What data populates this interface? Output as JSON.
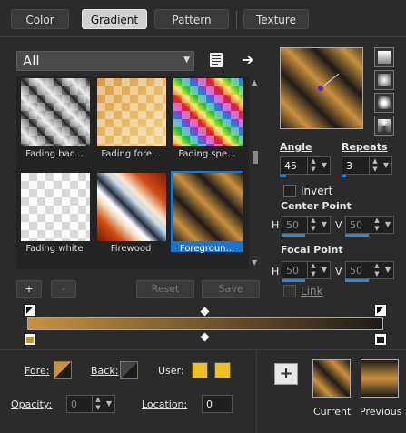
{
  "tabs": [
    {
      "label": "Color",
      "active": false
    },
    {
      "label": "Gradient",
      "active": true
    },
    {
      "label": "Pattern",
      "active": false
    },
    {
      "label": "Texture",
      "active": false
    }
  ],
  "library": {
    "selected": "All",
    "items": [
      {
        "label": "Fading bac...",
        "selected": false
      },
      {
        "label": "Fading fore...",
        "selected": false
      },
      {
        "label": "Fading spe...",
        "selected": false
      },
      {
        "label": "Fading white",
        "selected": false
      },
      {
        "label": "Firewood",
        "selected": false
      },
      {
        "label": "Foregroun...",
        "selected": true
      }
    ]
  },
  "controls": {
    "add": "+",
    "remove": "-",
    "reset": "Reset",
    "save": "Save"
  },
  "properties": {
    "angle_label": "Angle",
    "angle_value": "45",
    "repeats_label": "Repeats",
    "repeats_value": "3",
    "invert_label": "Invert",
    "center_label": "Center Point",
    "center_h": "50",
    "center_v": "50",
    "focal_label": "Focal Point",
    "focal_h": "50",
    "focal_v": "50",
    "h": "H",
    "v": "V",
    "link_label": "Link"
  },
  "bottom": {
    "fore_label": "Fore:",
    "back_label": "Back:",
    "user_label": "User:",
    "opacity_label": "Opacity:",
    "opacity_value": "0",
    "location_label": "Location:",
    "location_value": "0",
    "current_label": "Current",
    "previous_label": "Previous"
  },
  "colors": {
    "gold": "#c9913f",
    "dark": "#1e1b17",
    "user": "#f0c020",
    "accent": "#2e87d6"
  }
}
